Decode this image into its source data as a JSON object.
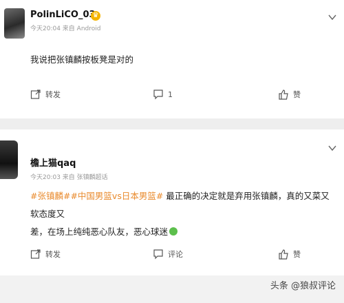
{
  "post1": {
    "username": "PolinLiCO_03",
    "meta": "今天20:04 来自 Android",
    "text": "我说把张镇麟按板凳是对的",
    "share_label": "转发",
    "comment_count": "1",
    "like_label": "赞"
  },
  "post2": {
    "username": "檐上猫qaq",
    "meta": "今天20:03 来自 张镇麟超话",
    "tags": [
      "#张镇麟#",
      "#中国男篮vs日本男篮#"
    ],
    "text_line1": " 最正确的决定就是弃用张镇麟，真的又菜又软态度又",
    "text_line2": "差，在场上纯纯恶心队友，恶心球迷",
    "share_label": "转发",
    "comment_label": "评论",
    "like_label": "赞"
  },
  "watermark": "头条 @狼叔评论",
  "colors": {
    "tag": "#e98a2c",
    "crown": "#f4b400",
    "divider": "#eeeeee"
  }
}
